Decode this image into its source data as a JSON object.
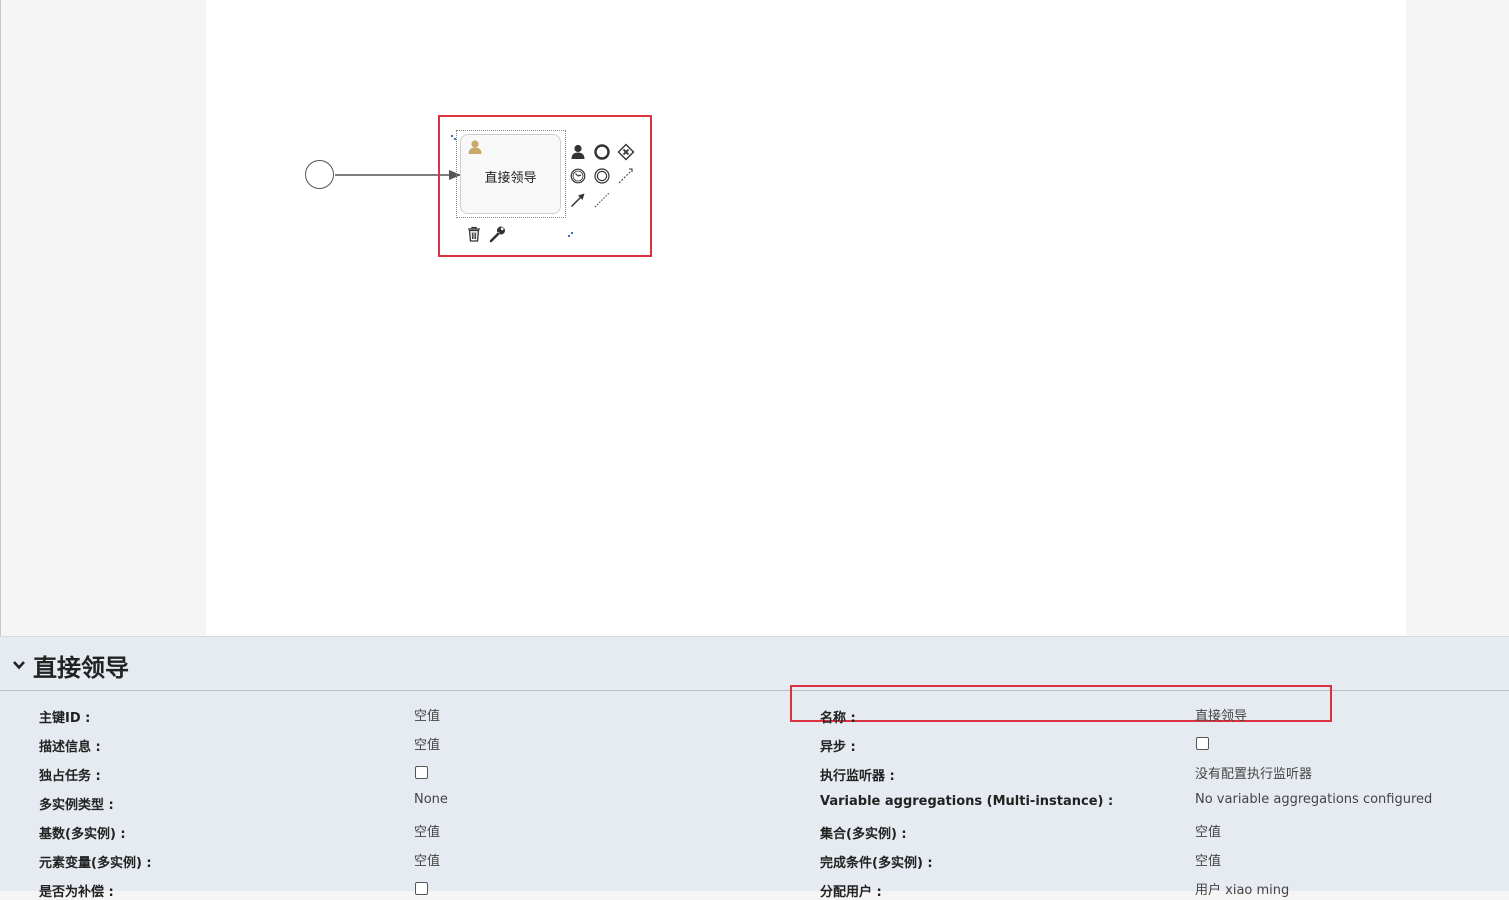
{
  "diagram": {
    "task_name": "直接领导"
  },
  "palette": {
    "highlight": "#d9333f",
    "canvas_bg": "#ffffff",
    "panel_bg": "#e6ebf1",
    "user_icon": "#c9a86a"
  },
  "tools": {
    "icons": [
      "user-task-icon",
      "end-event-icon",
      "gateway-icon",
      "intermediate-timer-icon",
      "intermediate-event-icon",
      "association-icon",
      "sequence-flow-icon",
      "dotted-connector-icon",
      "delete-icon",
      "wrench-icon"
    ]
  },
  "props": {
    "title": "直接领导",
    "left": [
      {
        "label": "主键ID :",
        "value": "空值",
        "type": "text"
      },
      {
        "label": "描述信息 :",
        "value": "空值",
        "type": "text"
      },
      {
        "label": "独占任务 :",
        "value": "",
        "type": "checkbox"
      },
      {
        "label": "多实例类型 :",
        "value": "None",
        "type": "text"
      },
      {
        "label": "基数(多实例) :",
        "value": "空值",
        "type": "text"
      },
      {
        "label": "元素变量(多实例) :",
        "value": "空值",
        "type": "text"
      },
      {
        "label": "是否为补偿 :",
        "value": "",
        "type": "checkbox"
      }
    ],
    "right": [
      {
        "label": "名称 :",
        "value": "直接领导",
        "type": "text"
      },
      {
        "label": "异步 :",
        "value": "",
        "type": "checkbox"
      },
      {
        "label": "执行监听器 :",
        "value": "没有配置执行监听器",
        "type": "text"
      },
      {
        "label": "Variable aggregations (Multi-instance) :",
        "value": "No variable aggregations configured",
        "type": "text"
      },
      {
        "label": "集合(多实例) :",
        "value": "空值",
        "type": "text"
      },
      {
        "label": "完成条件(多实例) :",
        "value": "空值",
        "type": "text"
      },
      {
        "label": "分配用户 :",
        "value": "用户 xiao ming",
        "type": "text"
      }
    ]
  }
}
